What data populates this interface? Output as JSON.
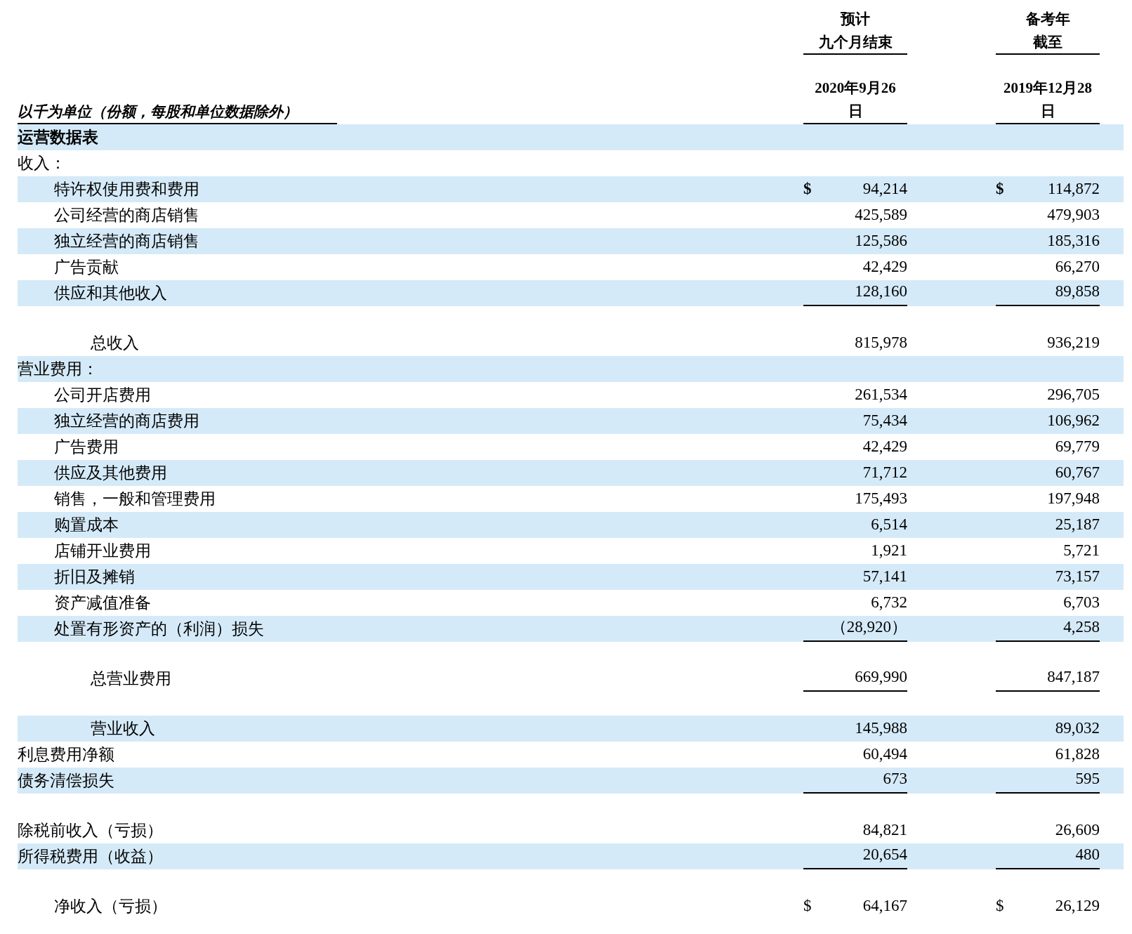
{
  "header": {
    "unit_note": "以千为单位（份额，每股和单位数据除外）",
    "columns": [
      {
        "lines": [
          "预计",
          "九个月结束"
        ],
        "date_lines": [
          "2020年9月26",
          "日"
        ]
      },
      {
        "lines": [
          "备考年",
          "截至"
        ],
        "date_lines": [
          "2019年12月28",
          "日"
        ]
      }
    ]
  },
  "rows": [
    {
      "kind": "section",
      "label": "运营数据表",
      "shaded": true
    },
    {
      "kind": "group",
      "label": "收入：",
      "shaded": false
    },
    {
      "kind": "item",
      "label": "特许权使用费和费用",
      "shaded": true,
      "values": [
        {
          "currency": "$",
          "amount": "94,214"
        },
        {
          "currency": "$",
          "amount": "114,872"
        }
      ]
    },
    {
      "kind": "item",
      "label": "公司经营的商店销售",
      "shaded": false,
      "values": [
        {
          "amount": "425,589"
        },
        {
          "amount": "479,903"
        }
      ]
    },
    {
      "kind": "item",
      "label": "独立经营的商店销售",
      "shaded": true,
      "values": [
        {
          "amount": "125,586"
        },
        {
          "amount": "185,316"
        }
      ]
    },
    {
      "kind": "item",
      "label": "广告贡献",
      "shaded": false,
      "values": [
        {
          "amount": "42,429"
        },
        {
          "amount": "66,270"
        }
      ]
    },
    {
      "kind": "item",
      "label": "供应和其他收入",
      "shaded": true,
      "rule_below": true,
      "values": [
        {
          "amount": "128,160"
        },
        {
          "amount": "89,858"
        }
      ]
    },
    {
      "kind": "total",
      "label": "总收入",
      "shaded": false,
      "gap_before": true,
      "values": [
        {
          "amount": "815,978"
        },
        {
          "amount": "936,219"
        }
      ]
    },
    {
      "kind": "group",
      "label": "营业费用：",
      "shaded": true
    },
    {
      "kind": "item",
      "label": "公司开店费用",
      "shaded": false,
      "values": [
        {
          "amount": "261,534"
        },
        {
          "amount": "296,705"
        }
      ]
    },
    {
      "kind": "item",
      "label": "独立经营的商店费用",
      "shaded": true,
      "values": [
        {
          "amount": "75,434"
        },
        {
          "amount": "106,962"
        }
      ]
    },
    {
      "kind": "item",
      "label": "广告费用",
      "shaded": false,
      "values": [
        {
          "amount": "42,429"
        },
        {
          "amount": "69,779"
        }
      ]
    },
    {
      "kind": "item",
      "label": "供应及其他费用",
      "shaded": true,
      "values": [
        {
          "amount": "71,712"
        },
        {
          "amount": "60,767"
        }
      ]
    },
    {
      "kind": "item",
      "label": "销售，一般和管理费用",
      "shaded": false,
      "values": [
        {
          "amount": "175,493"
        },
        {
          "amount": "197,948"
        }
      ]
    },
    {
      "kind": "item",
      "label": "购置成本",
      "shaded": true,
      "values": [
        {
          "amount": "6,514"
        },
        {
          "amount": "25,187"
        }
      ]
    },
    {
      "kind": "item",
      "label": "店铺开业费用",
      "shaded": false,
      "values": [
        {
          "amount": "1,921"
        },
        {
          "amount": "5,721"
        }
      ]
    },
    {
      "kind": "item",
      "label": "折旧及摊销",
      "shaded": true,
      "values": [
        {
          "amount": "57,141"
        },
        {
          "amount": "73,157"
        }
      ]
    },
    {
      "kind": "item",
      "label": "资产减值准备",
      "shaded": false,
      "values": [
        {
          "amount": "6,732"
        },
        {
          "amount": "6,703"
        }
      ]
    },
    {
      "kind": "item",
      "label": "处置有形资产的（利润）损失",
      "shaded": true,
      "rule_below": true,
      "values": [
        {
          "amount": "（28,920）"
        },
        {
          "amount": "4,258"
        }
      ]
    },
    {
      "kind": "total",
      "label": "总营业费用",
      "shaded": false,
      "gap_before": true,
      "rule_below": true,
      "values": [
        {
          "amount": "669,990"
        },
        {
          "amount": "847,187"
        }
      ]
    },
    {
      "kind": "total",
      "label": "营业收入",
      "shaded": true,
      "gap_before": true,
      "values": [
        {
          "amount": "145,988"
        },
        {
          "amount": "89,032"
        }
      ]
    },
    {
      "kind": "group",
      "label": "利息费用净额",
      "shaded": false,
      "values": [
        {
          "amount": "60,494"
        },
        {
          "amount": "61,828"
        }
      ]
    },
    {
      "kind": "group",
      "label": "债务清偿损失",
      "shaded": true,
      "rule_below": true,
      "values": [
        {
          "amount": "673"
        },
        {
          "amount": "595"
        }
      ]
    },
    {
      "kind": "group",
      "label": "除税前收入（亏损）",
      "shaded": false,
      "gap_before": true,
      "values": [
        {
          "amount": "84,821"
        },
        {
          "amount": "26,609"
        }
      ]
    },
    {
      "kind": "group",
      "label": "所得税费用（收益）",
      "shaded": true,
      "rule_below": true,
      "values": [
        {
          "amount": "20,654"
        },
        {
          "amount": "480"
        }
      ]
    },
    {
      "kind": "item",
      "label": "净收入（亏损）",
      "shaded": false,
      "gap_before": true,
      "values": [
        {
          "currency": "$",
          "amount": "64,167"
        },
        {
          "currency": "$",
          "amount": "26,129"
        }
      ]
    }
  ]
}
